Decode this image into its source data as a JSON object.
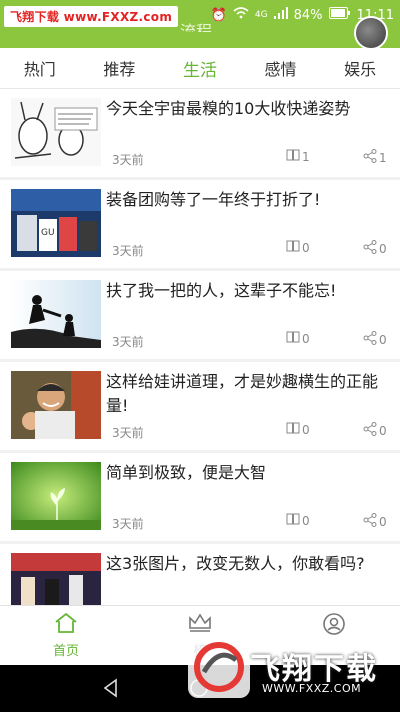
{
  "watermark": {
    "top_left": "飞翔下载 www.FXXZ.com",
    "bottom_right_title": "飞翔下载",
    "bottom_right_url": "WWW.FXXZ.COM"
  },
  "header": {
    "title": "流程"
  },
  "status": {
    "battery": "84%",
    "time": "11:11",
    "network": "4G"
  },
  "tabs": [
    {
      "label": "热门"
    },
    {
      "label": "推荐"
    },
    {
      "label": "生活",
      "active": true
    },
    {
      "label": "感情"
    },
    {
      "label": "娱乐"
    }
  ],
  "feed": [
    {
      "title": "今天全宇宙最糗的10大收快递姿势",
      "time": "3天前",
      "reads": "1",
      "shares": "1"
    },
    {
      "title": "装备团购等了一年终于打折了!",
      "time": "3天前",
      "reads": "0",
      "shares": "0"
    },
    {
      "title": "扶了我一把的人，这辈子不能忘!",
      "time": "3天前",
      "reads": "0",
      "shares": "0"
    },
    {
      "title": "这样给娃讲道理，才是妙趣横生的正能量!",
      "time": "3天前",
      "reads": "0",
      "shares": "0"
    },
    {
      "title": "简单到极致，便是大智",
      "time": "3天前",
      "reads": "0",
      "shares": "0"
    },
    {
      "title": "这3张图片，改变无数人，你敢看吗?",
      "time": "",
      "reads": "",
      "shares": ""
    }
  ],
  "bottom_nav": [
    {
      "label": "首页",
      "icon": "home-icon",
      "active": true
    },
    {
      "label": "榜",
      "icon": "crown-icon"
    },
    {
      "label": "",
      "icon": "user-icon"
    }
  ],
  "colors": {
    "accent": "#8cc63e",
    "tab_active": "#66b534"
  }
}
